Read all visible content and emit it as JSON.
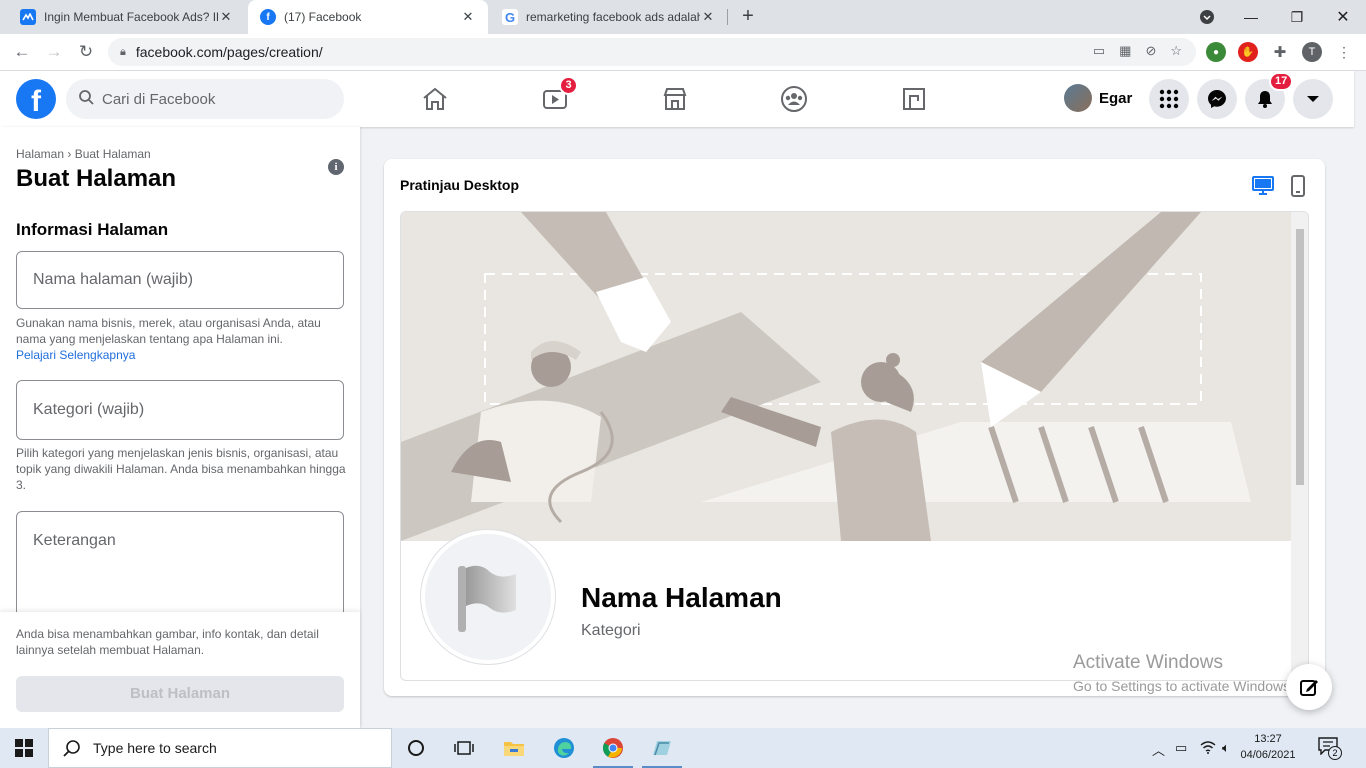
{
  "browser": {
    "tabs": [
      {
        "title": "Ingin Membuat Facebook Ads? Ik",
        "favicon": "facebook-ads-icon",
        "active": false
      },
      {
        "title": "(17) Facebook",
        "favicon": "facebook-icon",
        "active": true
      },
      {
        "title": "remarketing facebook ads adalah",
        "favicon": "google-icon",
        "active": false
      }
    ],
    "url": "facebook.com/pages/creation/",
    "profile_initial": "T"
  },
  "fb_header": {
    "search_placeholder": "Cari di Facebook",
    "watch_badge": "3",
    "notification_badge": "17",
    "profile_name": "Egar"
  },
  "left_panel": {
    "breadcrumb": "Halaman › Buat Halaman",
    "title": "Buat Halaman",
    "section_title": "Informasi Halaman",
    "name_placeholder": "Nama halaman (wajib)",
    "name_helper": "Gunakan nama bisnis, merek, atau organisasi Anda, atau nama yang menjelaskan tentang apa Halaman ini.",
    "learn_more": "Pelajari Selengkapnya",
    "category_placeholder": "Kategori (wajib)",
    "category_helper": "Pilih kategori yang menjelaskan jenis bisnis, organisasi, atau topik yang diwakili Halaman. Anda bisa menambahkan hingga 3.",
    "description_placeholder": "Keterangan",
    "bottom_note": "Anda bisa menambahkan gambar, info kontak, dan detail lainnya setelah membuat Halaman.",
    "create_button": "Buat Halaman"
  },
  "preview": {
    "title": "Pratinjau Desktop",
    "page_name": "Nama Halaman",
    "page_category": "Kategori"
  },
  "watermark": {
    "line1": "Activate Windows",
    "line2": "Go to Settings to activate Windows."
  },
  "taskbar": {
    "search_text": "Type here to search",
    "time": "13:27",
    "date": "04/06/2021",
    "notifications": "2"
  },
  "colors": {
    "fb_blue": "#1877f2",
    "badge_red": "#e41e3f",
    "cover_bg": "#e9e6e1"
  }
}
